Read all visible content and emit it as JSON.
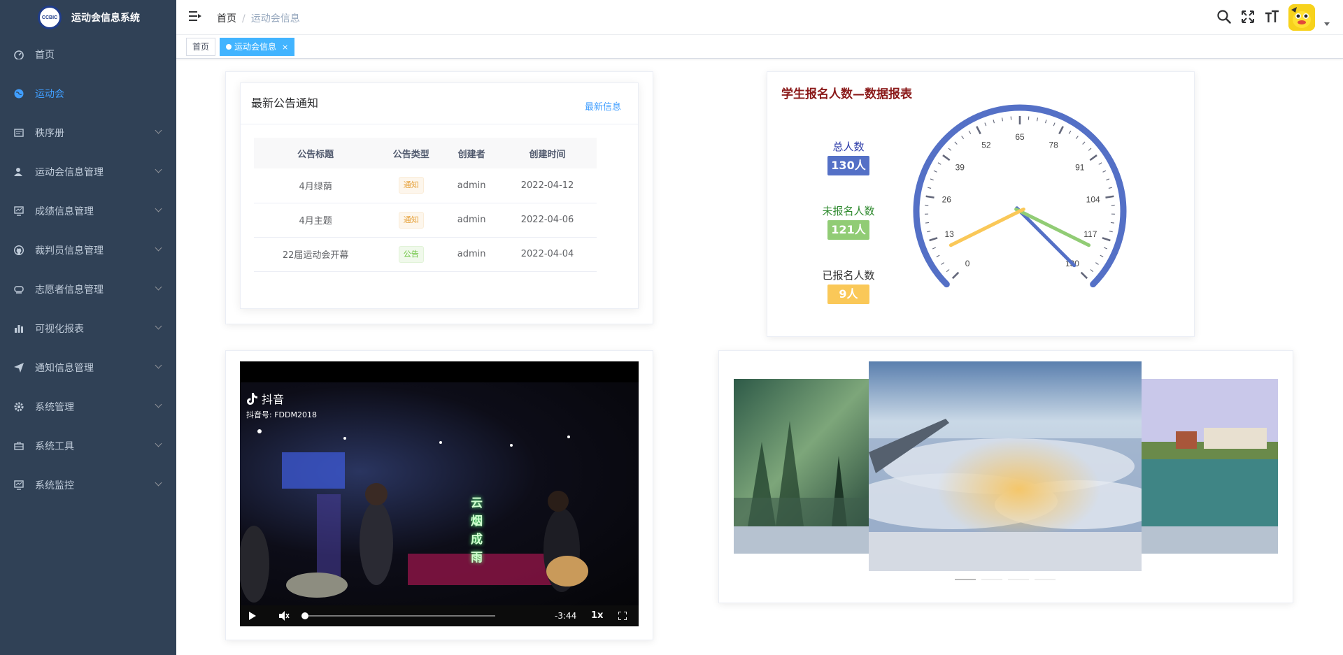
{
  "app": {
    "title": "运动会信息系统",
    "logo_text": "CCBIC"
  },
  "sidebar": {
    "items": [
      {
        "label": "首页",
        "icon": "dashboard-icon",
        "active": false,
        "arrow": false
      },
      {
        "label": "运动会",
        "icon": "globe-icon",
        "active": true,
        "arrow": false
      },
      {
        "label": "秩序册",
        "icon": "book-icon",
        "active": false,
        "arrow": true
      },
      {
        "label": "运动会信息管理",
        "icon": "user-icon",
        "active": false,
        "arrow": true
      },
      {
        "label": "成绩信息管理",
        "icon": "monitor-icon",
        "active": false,
        "arrow": true
      },
      {
        "label": "裁判员信息管理",
        "icon": "github-icon",
        "active": false,
        "arrow": true
      },
      {
        "label": "志愿者信息管理",
        "icon": "guide-icon",
        "active": false,
        "arrow": true
      },
      {
        "label": "可视化报表",
        "icon": "chart-icon",
        "active": false,
        "arrow": true
      },
      {
        "label": "通知信息管理",
        "icon": "send-icon",
        "active": false,
        "arrow": true
      },
      {
        "label": "系统管理",
        "icon": "gear-icon",
        "active": false,
        "arrow": true
      },
      {
        "label": "系统工具",
        "icon": "toolbox-icon",
        "active": false,
        "arrow": true
      },
      {
        "label": "系统监控",
        "icon": "monitor-icon",
        "active": false,
        "arrow": true
      }
    ]
  },
  "navbar": {
    "breadcrumb_home": "首页",
    "breadcrumb_sep": "/",
    "breadcrumb_current": "运动会信息"
  },
  "tags": {
    "home": "首页",
    "active": "运动会信息",
    "close": "×"
  },
  "notice": {
    "title": "最新公告通知",
    "more": "最新信息",
    "columns": [
      "公告标题",
      "公告类型",
      "创建者",
      "创建时间"
    ],
    "rows": [
      {
        "title": "4月绿荫",
        "type": "通知",
        "type_style": "warn",
        "creator": "admin",
        "date": "2022-04-12"
      },
      {
        "title": "4月主题",
        "type": "通知",
        "type_style": "warn",
        "creator": "admin",
        "date": "2022-04-06"
      },
      {
        "title": "22届运动会开幕",
        "type": "公告",
        "type_style": "ok",
        "creator": "admin",
        "date": "2022-04-04"
      }
    ]
  },
  "gauge": {
    "title": "学生报名人数—数据报表",
    "stats": [
      {
        "label": "总人数",
        "value": "130人",
        "color": "#5470c6"
      },
      {
        "label": "未报名人数",
        "value": "121人",
        "color": "#91cc75"
      },
      {
        "label": "已报名人数",
        "value": "9人",
        "color": "#fac858"
      }
    ],
    "ticks": [
      "0",
      "13",
      "26",
      "39",
      "52",
      "65",
      "78",
      "91",
      "104",
      "117",
      "130"
    ],
    "min": 0,
    "max": 130,
    "pointers": [
      {
        "value": 130,
        "color": "#5470c6"
      },
      {
        "value": 121,
        "color": "#91cc75"
      },
      {
        "value": 9,
        "color": "#fac858"
      }
    ]
  },
  "video": {
    "brand": "抖音",
    "account": "抖音号: FDDM2018",
    "neon_text": [
      "云",
      "烟",
      "成",
      "雨"
    ],
    "time": "-3:44",
    "speed": "1x"
  },
  "carousel": {
    "slides": 4,
    "active_index": 0
  }
}
